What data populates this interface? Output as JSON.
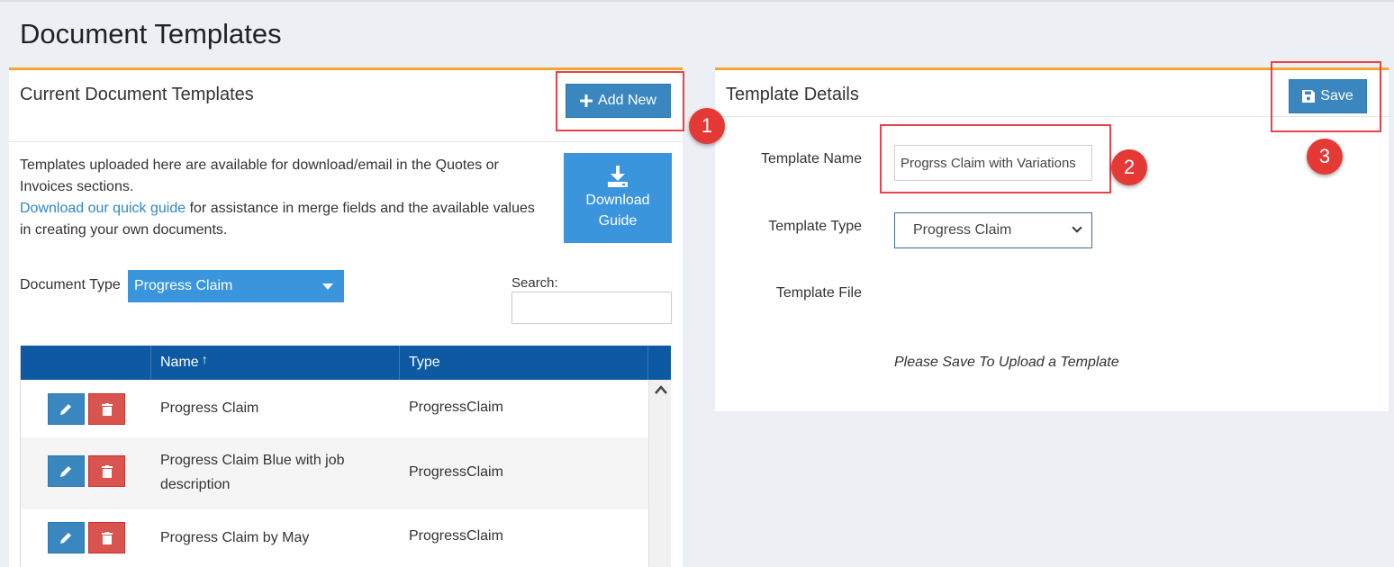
{
  "page": {
    "title": "Document Templates"
  },
  "left_panel": {
    "title": "Current Document Templates",
    "add_new_label": "Add New",
    "intro_text_1": "Templates uploaded here are available for download/email in the Quotes or Invoices sections.",
    "guide_link_text": "Download our quick guide",
    "intro_text_2": " for assistance in merge fields and the available values in creating your own documents.",
    "download_guide_label_1": "Download",
    "download_guide_label_2": "Guide",
    "document_type_label": "Document Type",
    "document_type_value": "Progress Claim",
    "search_label": "Search:",
    "search_value": "",
    "table": {
      "headers": [
        "",
        "Name",
        "Type"
      ],
      "sort_indicator": "↑",
      "rows": [
        {
          "name": "Progress Claim",
          "type": "ProgressClaim"
        },
        {
          "name": "Progress Claim Blue with job description",
          "type": "ProgressClaim"
        },
        {
          "name": "Progress Claim by May",
          "type": "ProgressClaim"
        }
      ]
    }
  },
  "right_panel": {
    "title": "Template Details",
    "save_label": "Save",
    "template_name_label": "Template Name",
    "template_name_value": "Progrss Claim with Variations",
    "template_type_label": "Template Type",
    "template_type_value": "Progress Claim",
    "template_file_label": "Template File",
    "upload_note": "Please Save To Upload a Template"
  },
  "annotations": {
    "step_1": "1",
    "step_2": "2",
    "step_3": "3"
  },
  "icons": {
    "add": "plus-icon",
    "save": "floppy-disk-icon",
    "download": "download-icon",
    "edit": "pencil-icon",
    "delete": "trash-icon",
    "sort": "sort-ascending-icon",
    "scroll_up": "chevron-up-icon"
  },
  "colors": {
    "accent_orange": "#f0a830",
    "primary_blue": "#3a87c0",
    "header_blue": "#0d5aa3",
    "danger_red": "#d9534f",
    "callout_red": "#e53935"
  }
}
